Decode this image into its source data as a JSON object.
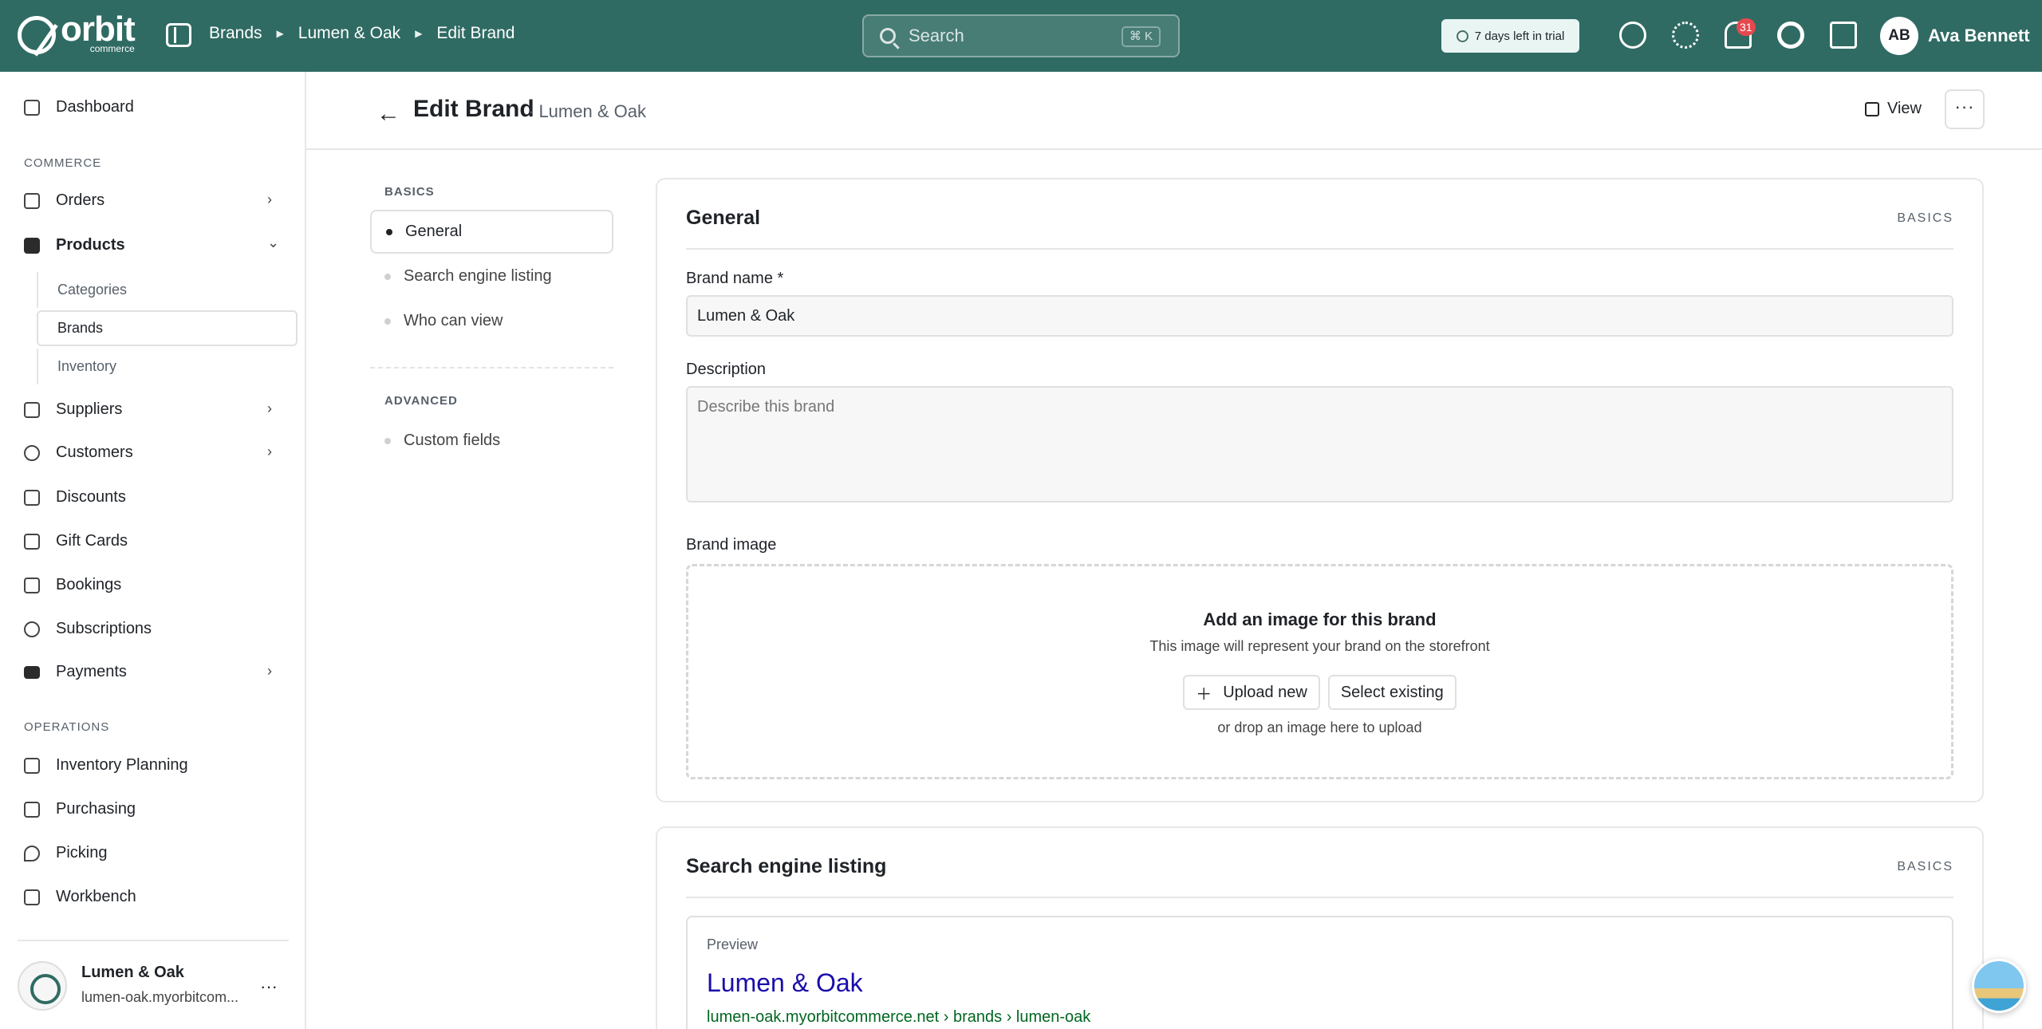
{
  "topbar": {
    "logo_word": "orbit",
    "logo_sub": "commerce",
    "breadcrumbs": [
      "Brands",
      "Lumen & Oak",
      "Edit Brand"
    ],
    "search_placeholder": "Search",
    "search_shortcut": "⌘ K",
    "trial_text": "7 days left in trial",
    "notifications_count": "31",
    "user_initials": "AB",
    "user_name": "Ava Bennett"
  },
  "sidebar": {
    "dashboard": "Dashboard",
    "section_commerce": "COMMERCE",
    "orders": "Orders",
    "products": "Products",
    "products_sub": [
      "Categories",
      "Brands",
      "Inventory"
    ],
    "suppliers": "Suppliers",
    "customers": "Customers",
    "discounts": "Discounts",
    "gift_cards": "Gift Cards",
    "bookings": "Bookings",
    "subscriptions": "Subscriptions",
    "payments": "Payments",
    "section_operations": "OPERATIONS",
    "inventory_planning": "Inventory Planning",
    "purchasing": "Purchasing",
    "picking": "Picking",
    "workbench": "Workbench",
    "store_name": "Lumen & Oak",
    "store_url": "lumen-oak.myorbitcom..."
  },
  "page": {
    "title": "Edit Brand",
    "subtitle": "· Lumen & Oak",
    "view_label": "View",
    "more_label": "···"
  },
  "subnav": {
    "section_basics": "BASICS",
    "general": "General",
    "seo": "Search engine listing",
    "who_can_view": "Who can view",
    "section_advanced": "ADVANCED",
    "custom_fields": "Custom fields"
  },
  "general_card": {
    "title": "General",
    "tag": "BASICS",
    "brand_name_label": "Brand name *",
    "brand_name_value": "Lumen & Oak",
    "description_label": "Description",
    "description_placeholder": "Describe this brand",
    "brand_image_label": "Brand image",
    "drop_heading": "Add an image for this brand",
    "drop_text": "This image will represent your brand on the storefront",
    "upload_new": "Upload new",
    "select_existing": "Select existing",
    "drop_hint": "or drop an image here to upload"
  },
  "seo_card": {
    "title": "Search engine listing",
    "tag": "BASICS",
    "preview_label": "Preview",
    "preview_title": "Lumen & Oak",
    "preview_url": "lumen-oak.myorbitcommerce.net › brands › lumen-oak"
  },
  "colors": {
    "topbar": "#2f6b63",
    "link_blue": "#1a0dab",
    "url_green": "#006621",
    "badge_red": "#e5484d"
  }
}
